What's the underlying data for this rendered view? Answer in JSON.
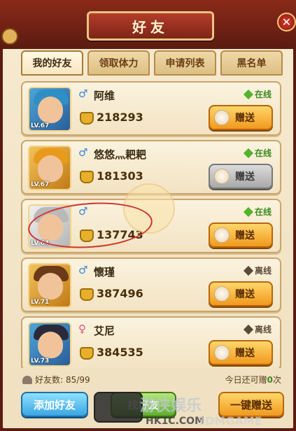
{
  "window": {
    "title": "好友",
    "close_icon": "close-icon"
  },
  "tabs": [
    {
      "label": "我的好友",
      "active": true
    },
    {
      "label": "领取体力",
      "active": false
    },
    {
      "label": "申请列表",
      "active": false
    },
    {
      "label": "黑名单",
      "active": false
    }
  ],
  "friends": [
    {
      "name": "阿维",
      "gender": "male",
      "gender_symbol": "♂",
      "level": "LV.67",
      "power": "218293",
      "status": "在线",
      "online": true,
      "gift_label": "赠送",
      "gift_enabled": true,
      "hair_color": "#2f8fc4"
    },
    {
      "name": "悠悠灬耙耙",
      "gender": "male",
      "gender_symbol": "♂",
      "level": "LV.67",
      "power": "181303",
      "status": "在线",
      "online": true,
      "gift_label": "赠送",
      "gift_enabled": false,
      "hair_color": "#e89a1a"
    },
    {
      "name": "",
      "gender": "male",
      "gender_symbol": "♂",
      "level": "LV.64",
      "power": "137743",
      "status": "在线",
      "online": true,
      "gift_label": "赠送",
      "gift_enabled": true,
      "hair_color": "#b9b9b9"
    },
    {
      "name": "懷瑾",
      "gender": "male",
      "gender_symbol": "♂",
      "level": "LV.71",
      "power": "387496",
      "status": "离线",
      "online": false,
      "gift_label": "赠送",
      "gift_enabled": true,
      "hair_color": "#6a3a1a"
    },
    {
      "name": "艾尼",
      "gender": "female",
      "gender_symbol": "♀",
      "level": "LV.73",
      "power": "384535",
      "status": "离线",
      "online": false,
      "gift_label": "赠送",
      "gift_enabled": true,
      "hair_color": "#2a2a3a"
    }
  ],
  "footer": {
    "friend_count_label": "好友数:",
    "friend_count_value": "85/99",
    "remain_prefix": "今日还可赠",
    "remain_value": "0",
    "remain_suffix": "次",
    "add_friend_label": "添加好友",
    "find_friend_label": "找好友",
    "one_click_gift_label": "一键赠送"
  },
  "watermark": {
    "text": "游侠娱乐",
    "url": "HK1C.COM",
    "brand": "3DMGAME"
  }
}
